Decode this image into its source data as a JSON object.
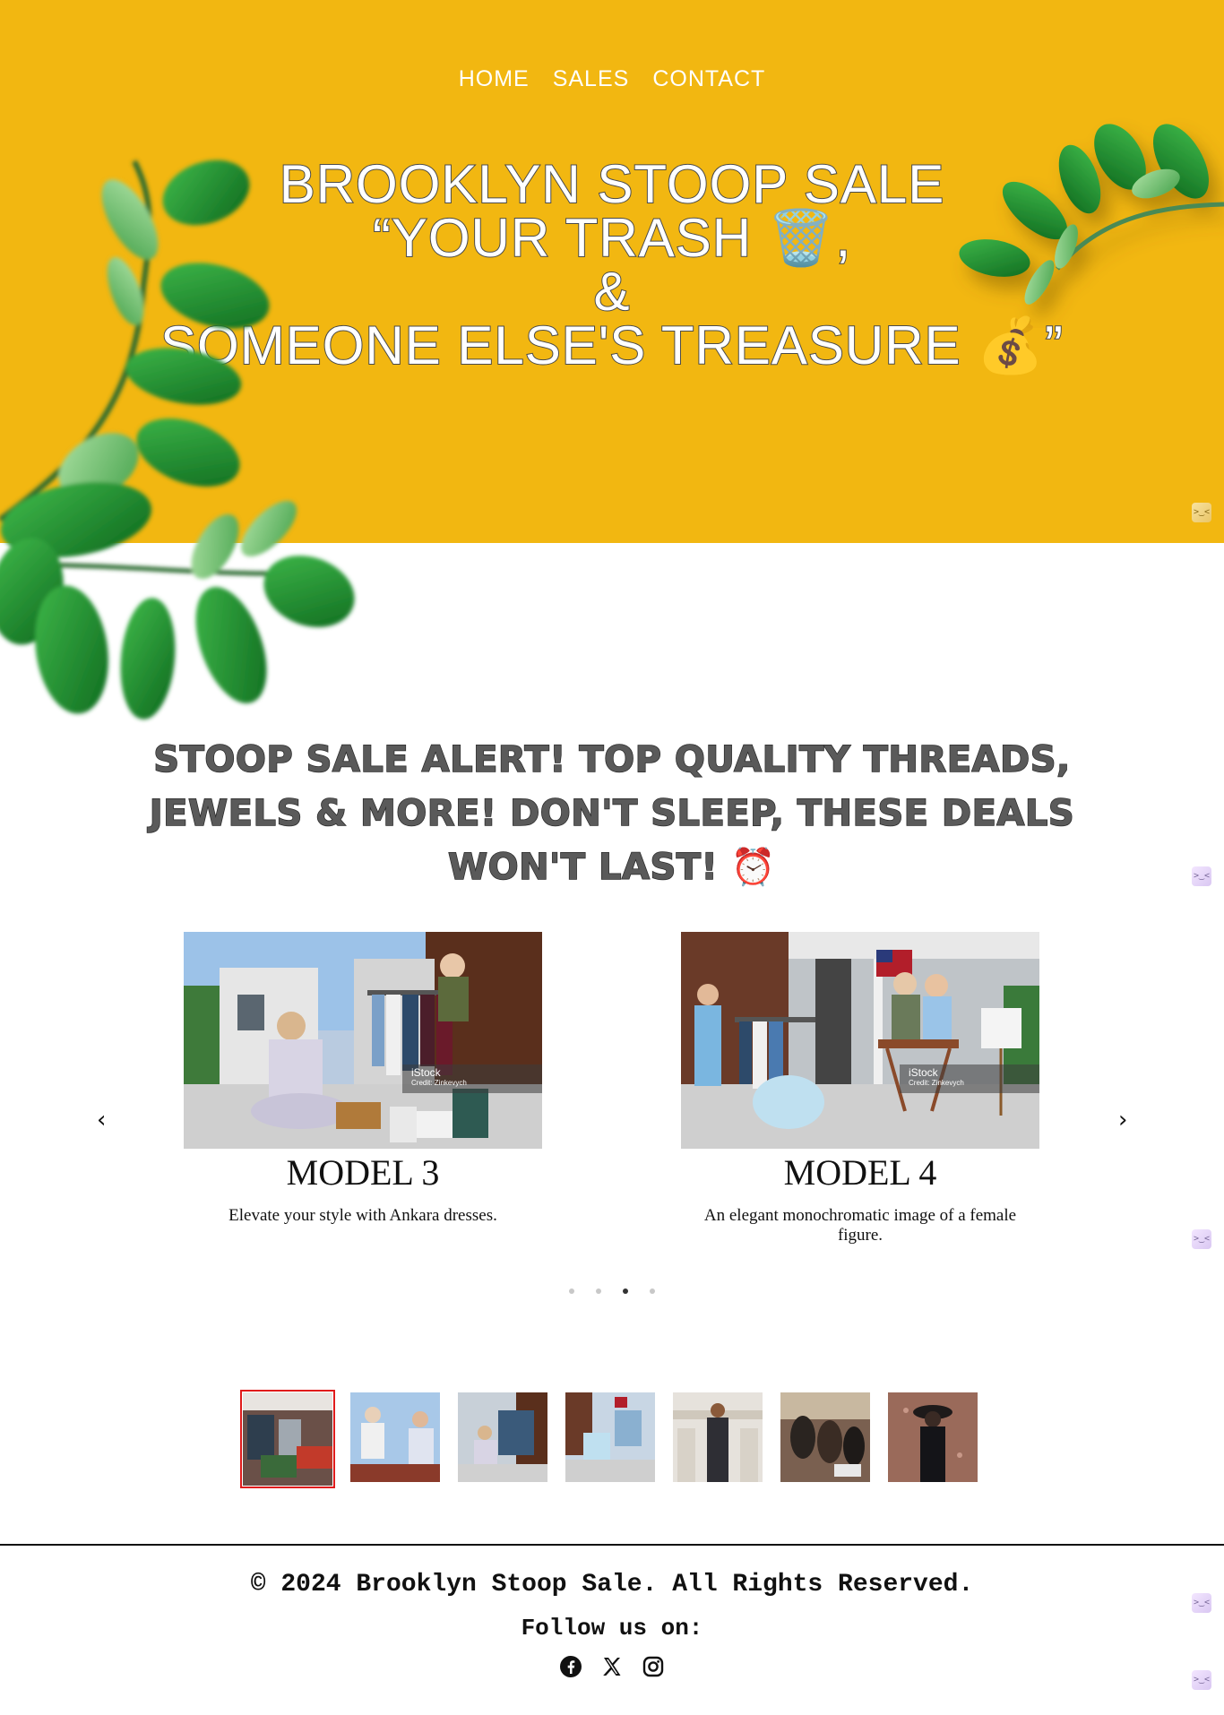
{
  "nav": {
    "items": [
      "HOME",
      "SALES",
      "CONTACT"
    ]
  },
  "hero": {
    "line1": "BROOKLYN STOOP SALE",
    "line2": "“YOUR TRASH 🗑️,",
    "line3": "&",
    "line4": "SOMEONE ELSE'S TREASURE 💰”"
  },
  "alert": {
    "text": "STOOP SALE ALERT! TOP QUALITY THREADS, JEWELS & MORE! DON'T SLEEP, THESE DEALS WON'T LAST! ⏰"
  },
  "carousel": {
    "prev": "‹",
    "next": "›",
    "slides": [
      {
        "title": "MODEL 3",
        "caption": "Elevate your style with Ankara dresses.",
        "watermark": "iStock",
        "credit": "Credit: Zinkevych"
      },
      {
        "title": "MODEL 4",
        "caption": "An elegant monochromatic image of a female figure.",
        "watermark": "iStock",
        "credit": "Credit: Zinkevych"
      }
    ],
    "dot_count": 4,
    "active_dot": 2
  },
  "thumbnails": {
    "count": 7,
    "active": 0
  },
  "footer": {
    "copyright": "© 2024 Brooklyn Stoop Sale. All Rights Reserved.",
    "follow": "Follow us on:",
    "social": [
      "facebook-icon",
      "x-icon",
      "instagram-icon"
    ]
  },
  "colors": {
    "hero_bg": "#f2b711",
    "active_thumb": "#e01b1b"
  }
}
